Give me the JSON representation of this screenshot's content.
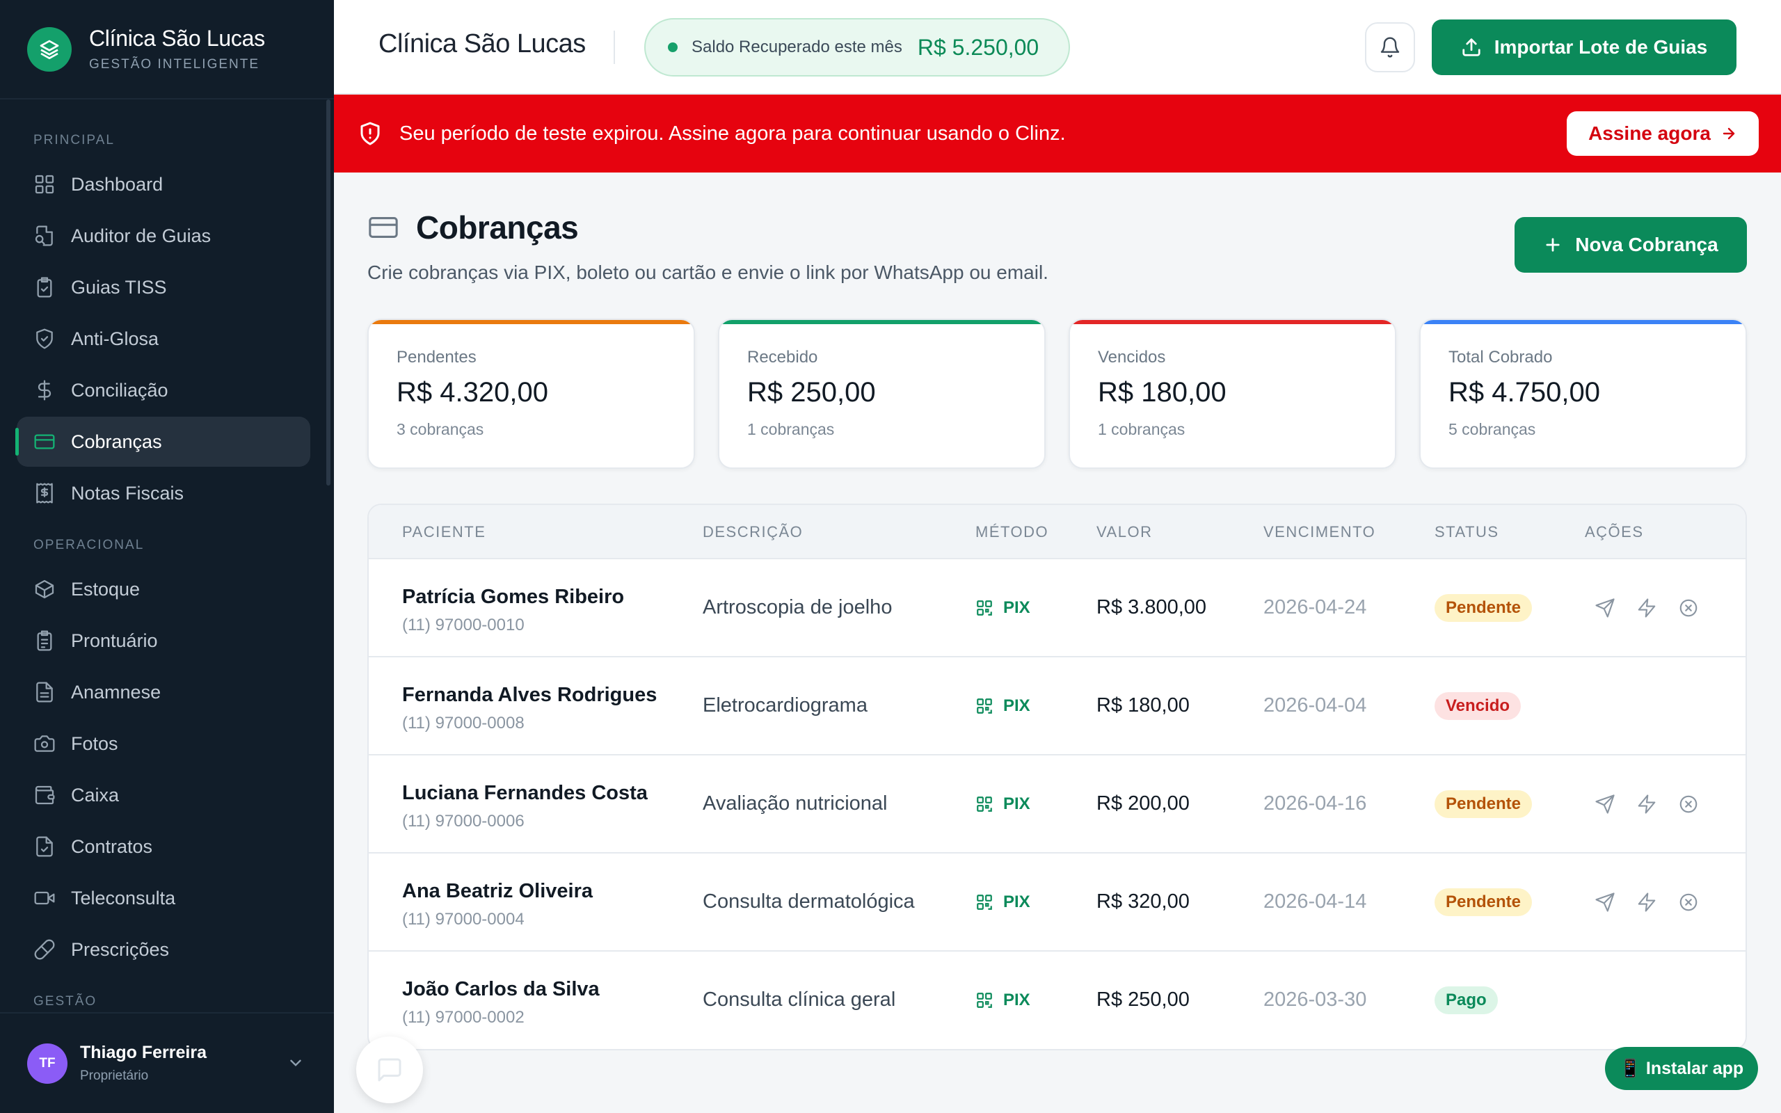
{
  "brand": {
    "name": "Clínica São Lucas",
    "subtitle": "GESTÃO INTELIGENTE"
  },
  "sidebar": {
    "sections": [
      {
        "title": "PRINCIPAL",
        "items": [
          {
            "label": "Dashboard",
            "icon": "grid-icon"
          },
          {
            "label": "Auditor de Guias",
            "icon": "file-search-icon"
          },
          {
            "label": "Guias TISS",
            "icon": "clipboard-check-icon"
          },
          {
            "label": "Anti-Glosa",
            "icon": "shield-check-icon"
          },
          {
            "label": "Conciliação",
            "icon": "dollar-icon"
          },
          {
            "label": "Cobranças",
            "icon": "credit-card-icon",
            "active": true
          },
          {
            "label": "Notas Fiscais",
            "icon": "receipt-icon"
          }
        ]
      },
      {
        "title": "OPERACIONAL",
        "items": [
          {
            "label": "Estoque",
            "icon": "package-icon"
          },
          {
            "label": "Prontuário",
            "icon": "clipboard-list-icon"
          },
          {
            "label": "Anamnese",
            "icon": "file-text-icon"
          },
          {
            "label": "Fotos",
            "icon": "camera-icon"
          },
          {
            "label": "Caixa",
            "icon": "wallet-icon"
          },
          {
            "label": "Contratos",
            "icon": "file-check-icon"
          },
          {
            "label": "Teleconsulta",
            "icon": "video-icon"
          },
          {
            "label": "Prescrições",
            "icon": "pill-icon"
          }
        ]
      },
      {
        "title": "GESTÃO",
        "items": []
      }
    ]
  },
  "user": {
    "initials": "TF",
    "name": "Thiago Ferreira",
    "role": "Proprietário"
  },
  "header": {
    "title": "Clínica São Lucas",
    "saldo_label": "Saldo Recuperado este mês",
    "saldo_value": "R$ 5.250,00",
    "import_label": "Importar Lote de Guias"
  },
  "banner": {
    "text": "Seu período de teste expirou. Assine agora para continuar usando o Clinz.",
    "button": "Assine agora",
    "color": "#e6030f"
  },
  "page": {
    "title": "Cobranças",
    "subtitle": "Crie cobranças via PIX, boleto ou cartão e envie o link por WhatsApp ou email.",
    "new_button": "Nova Cobrança"
  },
  "cards": [
    {
      "label": "Pendentes",
      "value": "R$ 4.320,00",
      "count": "3 cobranças",
      "accent": "#ea7a0e"
    },
    {
      "label": "Recebido",
      "value": "R$ 250,00",
      "count": "1 cobranças",
      "accent": "#12a06a"
    },
    {
      "label": "Vencidos",
      "value": "R$ 180,00",
      "count": "1 cobranças",
      "accent": "#e32626"
    },
    {
      "label": "Total Cobrado",
      "value": "R$ 4.750,00",
      "count": "5 cobranças",
      "accent": "#3b82f6"
    }
  ],
  "table": {
    "headers": [
      "PACIENTE",
      "DESCRIÇÃO",
      "MÉTODO",
      "VALOR",
      "VENCIMENTO",
      "STATUS",
      "AÇÕES"
    ],
    "rows": [
      {
        "name": "Patrícia Gomes Ribeiro",
        "phone": "(11) 97000-0010",
        "desc": "Artroscopia de joelho",
        "method": "PIX",
        "value": "R$ 3.800,00",
        "due": "2026-04-24",
        "status": "Pendente",
        "status_kind": "pendente",
        "actions": true
      },
      {
        "name": "Fernanda Alves Rodrigues",
        "phone": "(11) 97000-0008",
        "desc": "Eletrocardiograma",
        "method": "PIX",
        "value": "R$ 180,00",
        "due": "2026-04-04",
        "status": "Vencido",
        "status_kind": "vencido",
        "actions": false
      },
      {
        "name": "Luciana Fernandes Costa",
        "phone": "(11) 97000-0006",
        "desc": "Avaliação nutricional",
        "method": "PIX",
        "value": "R$ 200,00",
        "due": "2026-04-16",
        "status": "Pendente",
        "status_kind": "pendente",
        "actions": true
      },
      {
        "name": "Ana Beatriz Oliveira",
        "phone": "(11) 97000-0004",
        "desc": "Consulta dermatológica",
        "method": "PIX",
        "value": "R$ 320,00",
        "due": "2026-04-14",
        "status": "Pendente",
        "status_kind": "pendente",
        "actions": true
      },
      {
        "name": "João Carlos da Silva",
        "phone": "(11) 97000-0002",
        "desc": "Consulta clínica geral",
        "method": "PIX",
        "value": "R$ 250,00",
        "due": "2026-03-30",
        "status": "Pago",
        "status_kind": "pago",
        "actions": false
      }
    ]
  },
  "install_label": "📱 Instalar app"
}
